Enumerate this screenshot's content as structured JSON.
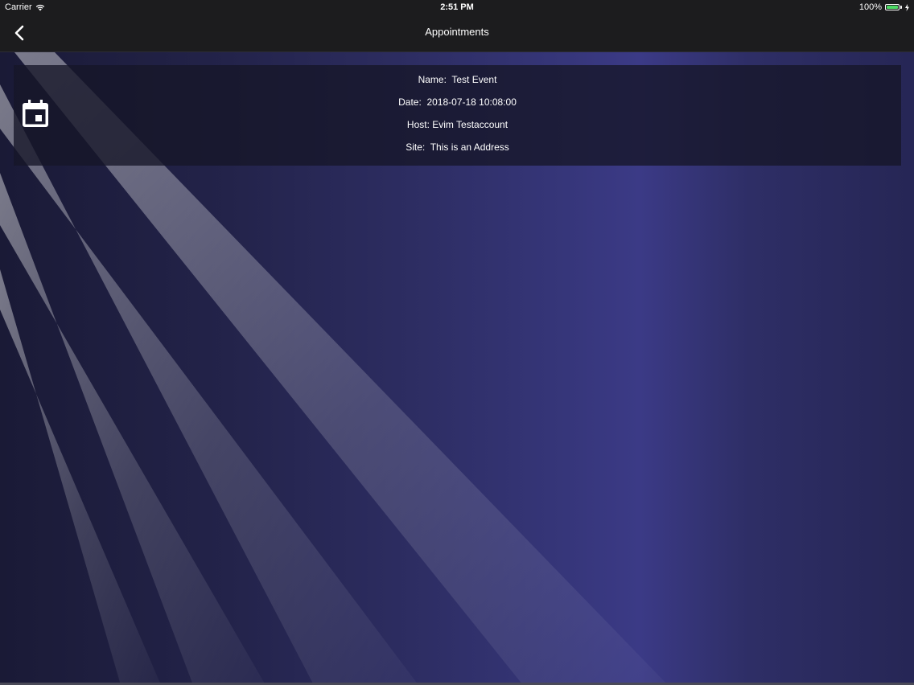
{
  "status_bar": {
    "carrier": "Carrier",
    "time": "2:51 PM",
    "battery": "100%",
    "battery_color": "#4cd964"
  },
  "nav_bar": {
    "title": "Appointments",
    "back_icon": "chevron-left-icon"
  },
  "appointment": {
    "icon": "calendar-icon",
    "name": "Name:  Test Event",
    "date": "Date:  2018-07-18 10:08:00",
    "host": "Host: Evim Testaccount",
    "site": "Site:  This is an Address"
  },
  "colors": {
    "bar_background": "#1c1c1e",
    "card_background": "#161628",
    "background_accent": "#3b3a86"
  }
}
